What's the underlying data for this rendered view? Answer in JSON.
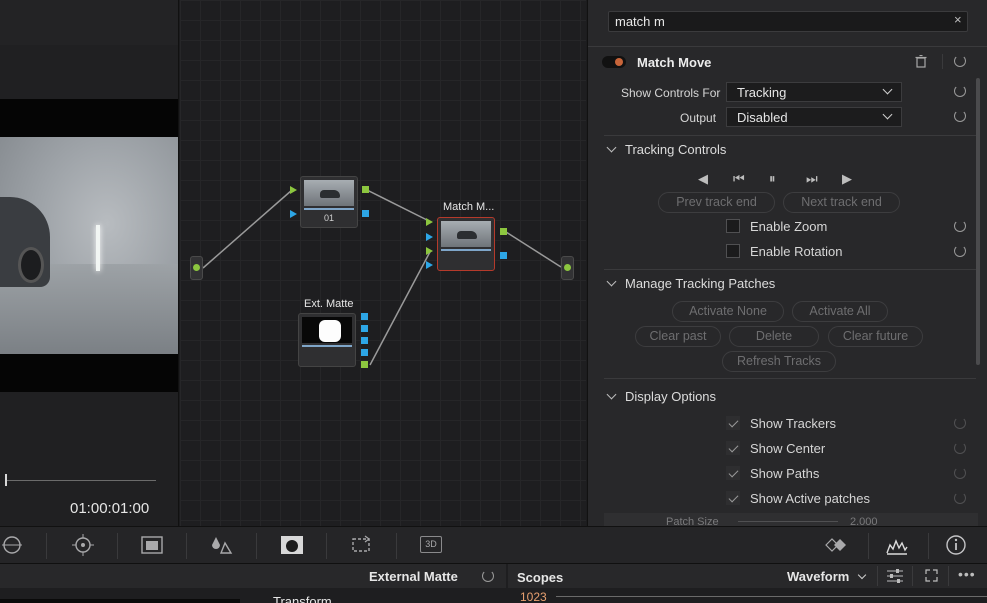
{
  "viewer": {
    "timecode": "01:00:01:00"
  },
  "nodes": {
    "node1_label": "01",
    "match_move_title": "Match M...",
    "ext_matte_title": "Ext. Matte"
  },
  "inspector": {
    "search_value": "match m",
    "search_clear": "×",
    "tool_title": "Match Move",
    "show_controls_label": "Show Controls For",
    "show_controls_value": "Tracking",
    "output_label": "Output",
    "output_value": "Disabled",
    "tracking_controls": {
      "header": "Tracking Controls",
      "buttons": {
        "track_reverse": "◀",
        "step_back": "⏮",
        "pause": "⏸",
        "step_forward": "⏭",
        "track_forward": "▶"
      },
      "prev_track_end": "Prev track end",
      "next_track_end": "Next track end",
      "enable_zoom": "Enable Zoom",
      "enable_rotation": "Enable Rotation"
    },
    "manage_patches": {
      "header": "Manage Tracking Patches",
      "activate_none": "Activate None",
      "activate_all": "Activate All",
      "clear_past": "Clear past",
      "delete": "Delete",
      "clear_future": "Clear future",
      "refresh_tracks": "Refresh Tracks"
    },
    "display_options": {
      "header": "Display Options",
      "show_trackers": "Show Trackers",
      "show_center": "Show Center",
      "show_paths": "Show Paths",
      "show_active_patches": "Show Active patches"
    },
    "patch_size_label": "Patch Size",
    "patch_size_value": "2.000"
  },
  "toolbar": {
    "icons": [
      "circle-window-icon",
      "tracker-icon",
      "image-wipe-icon",
      "color-drops-icon",
      "matte-icon",
      "sizing-icon",
      "3d-icon",
      "keyframe-icon",
      "scope-icon",
      "info-icon"
    ],
    "label_3d": "3D"
  },
  "bottom": {
    "external_matte": "External Matte",
    "transform": "Transform",
    "scopes": "Scopes",
    "waveform": "Waveform",
    "scope_value": "1023"
  }
}
